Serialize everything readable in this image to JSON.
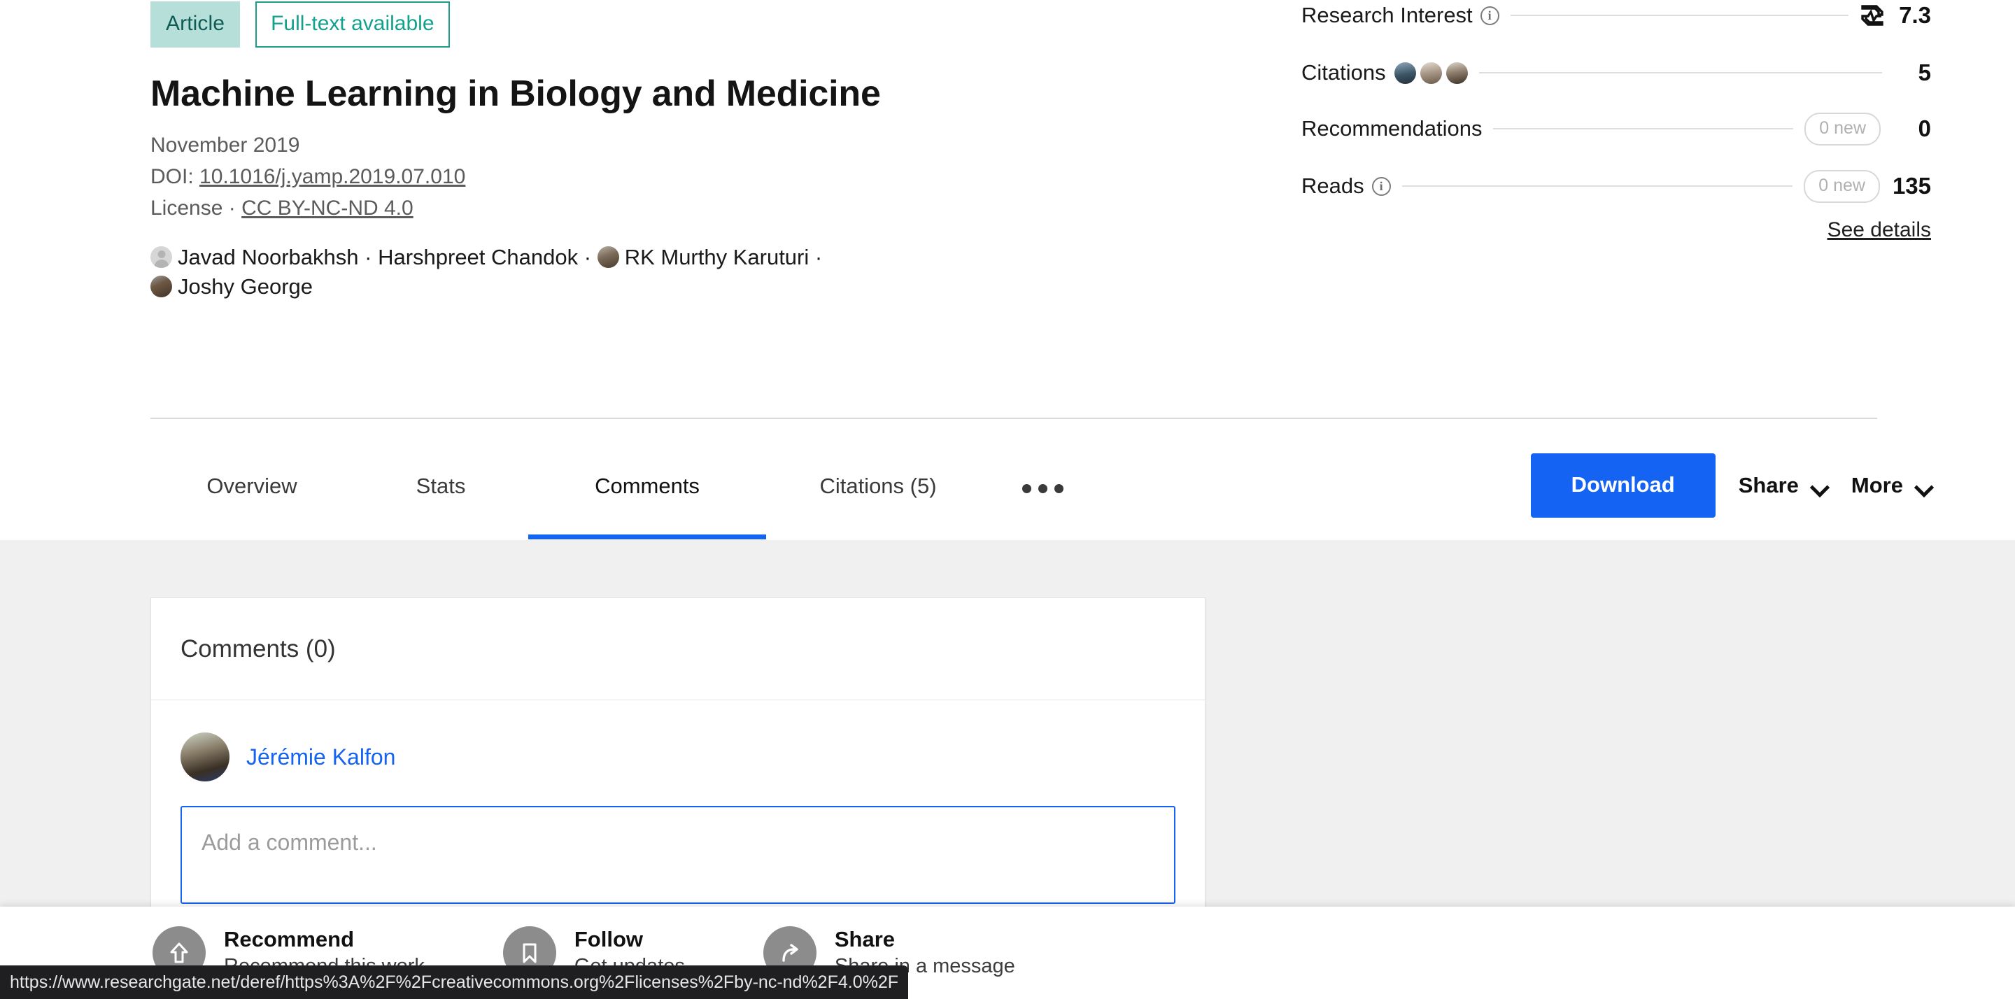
{
  "publication": {
    "badges": {
      "type": "Article",
      "fulltext": "Full-text available"
    },
    "title": "Machine Learning in Biology and Medicine",
    "date": "November 2019",
    "doi_label": "DOI:",
    "doi_value": "10.1016/j.yamp.2019.07.010",
    "license_label": "License ·",
    "license_value": "CC BY-NC-ND 4.0",
    "authors": [
      {
        "name": "Javad Noorbakhsh",
        "avatar": "generic-avatar"
      },
      {
        "name": "Harshpreet Chandok",
        "avatar": "none"
      },
      {
        "name": "RK Murthy Karuturi",
        "avatar": "photo-avatar"
      },
      {
        "name": "Joshy George",
        "avatar": "photo-avatar"
      }
    ],
    "author_separator": "·"
  },
  "stats": {
    "rows": [
      {
        "label": "Research Interest",
        "has_info": true,
        "icon": "research-interest-icon",
        "pill": "",
        "value": "7.3"
      },
      {
        "label": "Citations",
        "has_info": false,
        "avatars": 3,
        "pill": "",
        "value": "5"
      },
      {
        "label": "Recommendations",
        "has_info": false,
        "pill": "0 new",
        "value": "0"
      },
      {
        "label": "Reads",
        "has_info": true,
        "pill": "0 new",
        "value": "135"
      }
    ],
    "see_details": "See details"
  },
  "tabs": [
    {
      "label": "Overview",
      "active": false
    },
    {
      "label": "Stats",
      "active": false
    },
    {
      "label": "Comments",
      "active": true
    },
    {
      "label": "Citations (5)",
      "active": false
    },
    {
      "label": "",
      "active": false,
      "icon": "more-dots-icon"
    }
  ],
  "actions": {
    "download": "Download",
    "share": "Share",
    "more": "More"
  },
  "comments": {
    "heading": "Comments (0)",
    "commenter": "Jérémie Kalfon",
    "input_placeholder": "Add a comment..."
  },
  "bottom_bar": [
    {
      "title": "Recommend",
      "subtitle": "Recommend this work",
      "icon": "arrow-up-icon"
    },
    {
      "title": "Follow",
      "subtitle": "Get updates",
      "icon": "bookmark-icon"
    },
    {
      "title": "Share",
      "subtitle": "Share in a message",
      "icon": "share-arrow-icon"
    }
  ],
  "status_bar": {
    "url": "https://www.researchgate.net/deref/https%3A%2F%2Fcreativecommons.org%2Flicenses%2Fby-nc-nd%2F4.0%2F"
  },
  "colors": {
    "accent_blue": "#1463f3",
    "badge_teal_bg": "#b5dfd8",
    "badge_teal_text": "#0f5c55",
    "fulltext_green": "#13a18d",
    "body_gray": "#f0f0f0"
  }
}
